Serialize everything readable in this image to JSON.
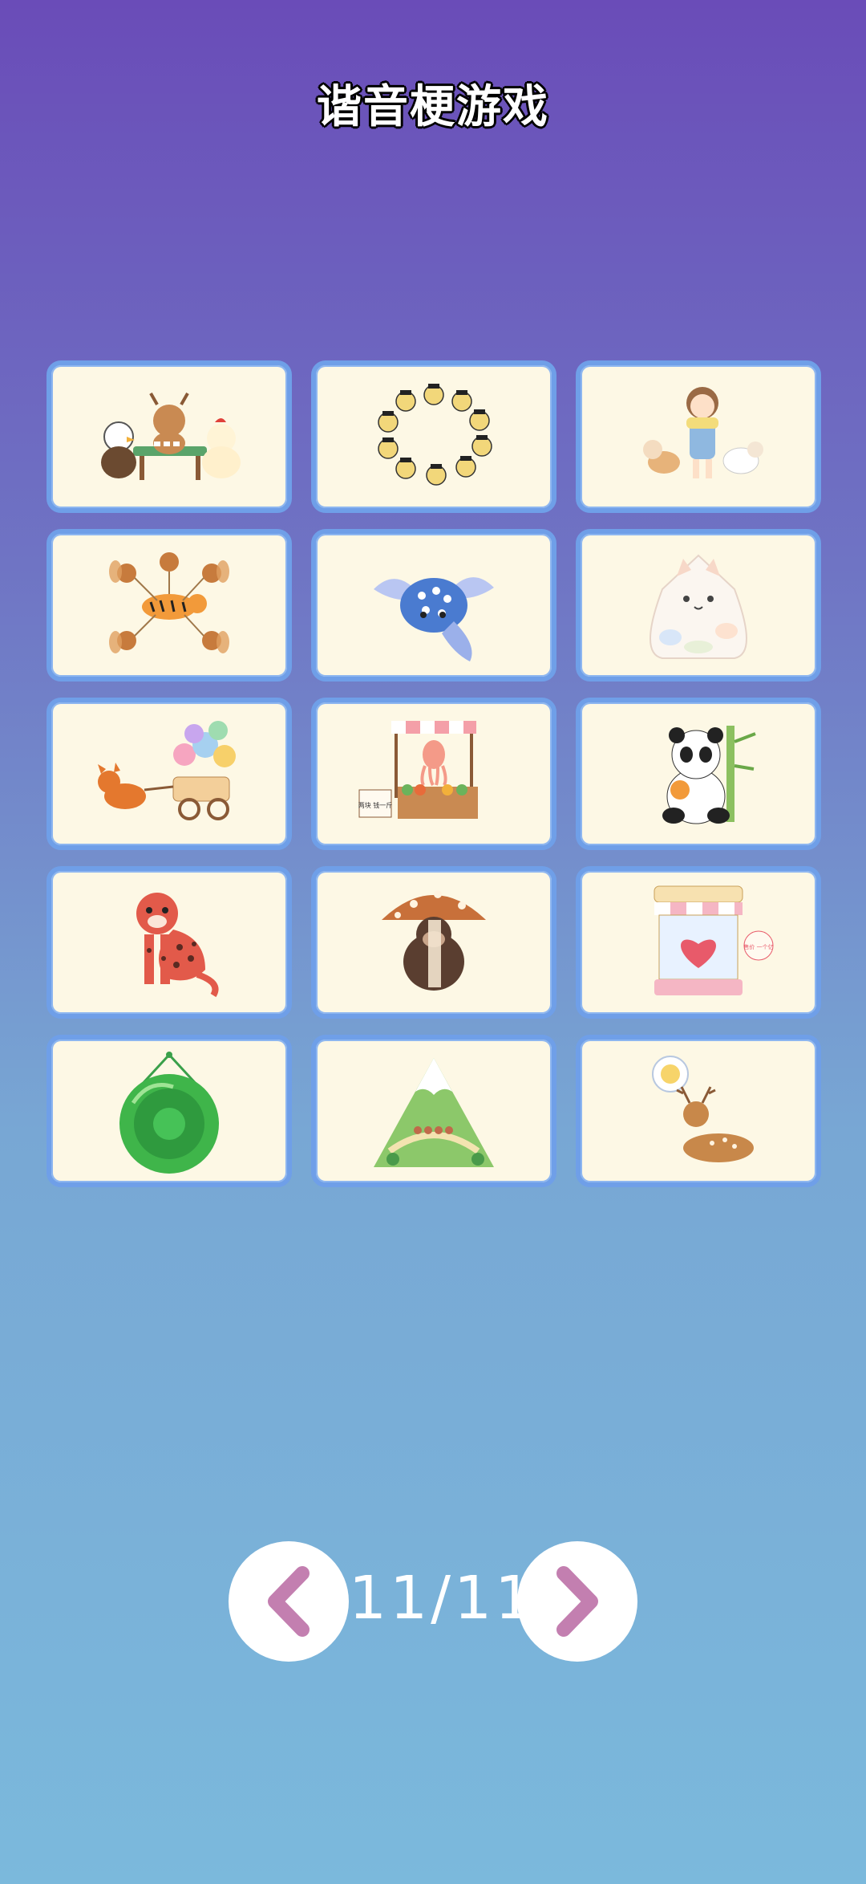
{
  "title": "谐音梗游戏",
  "pagination": {
    "current": 11,
    "total": 11,
    "label": "11/11"
  },
  "cards": [
    {
      "icon": "animals-playing-mahjong-icon"
    },
    {
      "icon": "figures-in-circle-icon"
    },
    {
      "icon": "girl-with-dog-and-sheep-icon"
    },
    {
      "icon": "squirrels-around-tiger-icon"
    },
    {
      "icon": "blue-winged-fish-icon"
    },
    {
      "icon": "chubby-cat-icon"
    },
    {
      "icon": "fox-pulling-lollipop-cart-icon"
    },
    {
      "icon": "squid-at-market-stall-icon",
      "sign_text": "两块 钱一斤"
    },
    {
      "icon": "panda-with-bamboo-icon"
    },
    {
      "icon": "red-leopard-icon"
    },
    {
      "icon": "gorilla-under-mushroom-icon"
    },
    {
      "icon": "heart-claw-machine-icon",
      "sign_text": "售价 一个亿"
    },
    {
      "icon": "green-gong-icon"
    },
    {
      "icon": "snowy-mountain-icon"
    },
    {
      "icon": "deer-dreaming-chick-icon"
    }
  ],
  "colors": {
    "card_bg": "#fdf8e5",
    "card_border": "#6f9fe8",
    "arrow": "#c37fb0"
  }
}
